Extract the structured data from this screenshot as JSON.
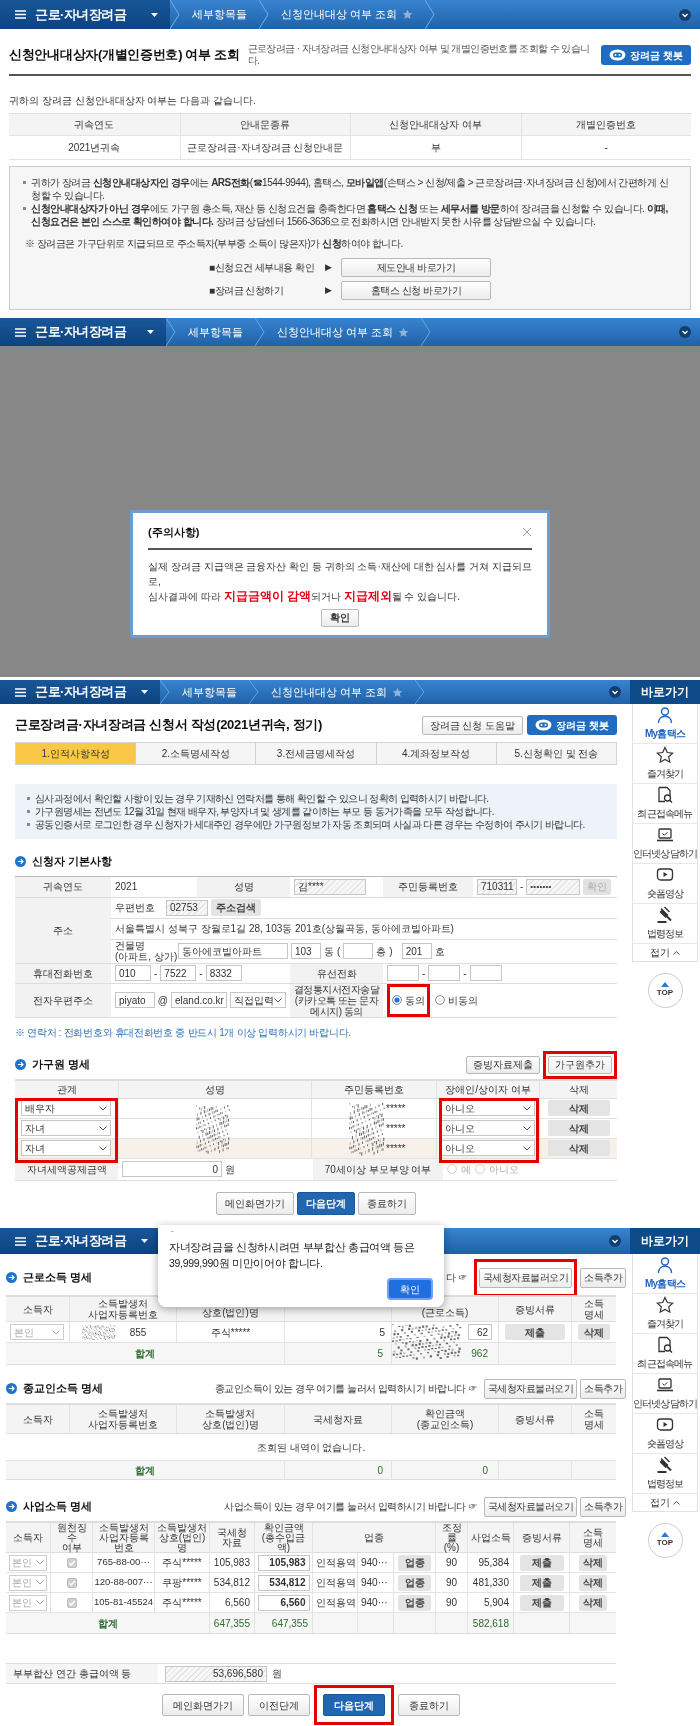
{
  "screen1": {
    "nav": {
      "menu": "근로·자녀장려금",
      "breadcrumbs": [
        {
          "label": "세부항목들"
        },
        {
          "label": "신청안내대상 여부 조회",
          "favorite": false
        }
      ]
    },
    "title": "신청안내대상자(개별인증번호) 여부 조회",
    "subtitle": "근로장려금 · 자녀장려금 신청안내대상자 여부 및 개별인증번호를 조회할 수 있습니다.",
    "chatbot": "장려금 챗봇",
    "intro": "귀하의 장려금 신청안내대상자 여부는 다음과 같습니다.",
    "table": {
      "columns": [
        "귀속연도",
        "안내문종류",
        "신청안내대상자 여부",
        "개별인증번호"
      ],
      "rows": [
        [
          "2021년귀속",
          "근로장려금·자녀장려금 신청안내문",
          "부",
          "-"
        ]
      ]
    },
    "notices": [
      "귀하가 장려금 **신청안내대상자인 경우**에는 **ARS전화**(☎1544-9944), 홈택스, **모바일앱**(손택스 > 신청/제출 > 근로장려금·자녀장려금 신청)에서 간편하게 신청할 수 있습니다.",
      "**신청안내대상자가 아닌 경우**에도 가구원 총소득, 재산 등 신청요건을 충족한다면 **홈택스 신청** 또는 **세무서를 방문**하여 장려금을 신청할 수 있습니다. **이때, 신청요건은 본인 스스로 확인하여야 합니다.** 장려금 상담센터 1566-3636으로 전화하시면 안내받지 못한 사유를 상담받으실 수 있습니다."
    ],
    "note": "※ 장려금은 가구단위로 지급되므로 주소득자(부부중 소득이 많은자)가 **신청**하여야 합니다.",
    "links": [
      {
        "label": "■신청요건 세부내용 확인",
        "arrow": "▶",
        "button": "제도안내 바로가기"
      },
      {
        "label": "■장려금 신청하기",
        "arrow": "▶",
        "button": "홈택스 신청 바로가기"
      }
    ]
  },
  "screen2": {
    "nav": {
      "menu": "근로·자녀장려금",
      "breadcrumbs": [
        {
          "label": "세부항목들"
        },
        {
          "label": "신청안내대상 여부 조회",
          "favorite": false
        }
      ]
    },
    "dialog": {
      "title": "(주의사항)",
      "lines": [
        "실제 장려금 지급액은 금융자산 확인 등 귀하의 소득·재산에 대한 심사를 거쳐 지급되므로,",
        "심사결과에 따라 **지급금액이 감액**되거나 **지급제외**될 수 있습니다."
      ],
      "button": "확인"
    }
  },
  "screen3": {
    "nav": {
      "menu": "근로·자녀장려금",
      "breadcrumbs": [
        {
          "label": "세부항목들"
        },
        {
          "label": "신청안내대상 여부 조회",
          "favorite": false
        }
      ]
    },
    "quick_menu": {
      "title": "바로가기",
      "items": [
        {
          "label": "My홈택스",
          "selected": true
        },
        {
          "label": "즐겨찾기",
          "selected": false
        },
        {
          "label": "최근접속메뉴",
          "selected": false
        },
        {
          "label": "인터넷상담하기",
          "selected": false
        },
        {
          "label": "숏폼영상",
          "selected": false
        },
        {
          "label": "법령정보",
          "selected": false
        }
      ],
      "collapse": "접기",
      "top": "TOP"
    },
    "title": "근로장려금·자녀장려금 신청서 작성(2021년귀속, 정기)",
    "help_button": "장려금 신청 도움말",
    "chatbot": "장려금 챗봇",
    "steps": [
      {
        "label": "1.인적사항작성",
        "selected": true
      },
      {
        "label": "2.소득명세작성",
        "selected": false
      },
      {
        "label": "3.전세금명세작성",
        "selected": false
      },
      {
        "label": "4.계좌정보작성",
        "selected": false
      },
      {
        "label": "5.신청확인 및 전송",
        "selected": false
      }
    ],
    "notices": [
      "심사과정에서 확인할 사항이 있는 경우 기재하신 연락처를 통해 확인할 수 있으니 정확히 입력하시기 바랍니다.",
      "가구원명세는 전년도 12월 31일 현재 배우자, 부양자녀 및 생계를 같이하는 부모 등 동거가족을 모두 작성합니다.",
      "공동인증서로 로그인한 경우 신청자가 세대주인 경우에만 가구원정보가 자동 조회되며 사실과 다른 경우는 수정하여 주시기 바랍니다."
    ],
    "basic": {
      "title": "신청자 기본사항",
      "year_label": "귀속연도",
      "year": "2021",
      "name_label": "성명",
      "name": "김****",
      "rrn_label": "주민등록번호",
      "rrn_front": "710311",
      "dash": "-",
      "rrn_back": "• • • • • • •",
      "rrn_confirm": "확인",
      "rrn_confirm_disabled": true,
      "address_label": "주소",
      "postal_label": "우편번호",
      "postal": "02753",
      "address_search": "주소검색",
      "address": "서울특별시 성북구 장월로1길 28, 103동 201호(상월곡동, 동아에코빌아파트)",
      "building_label": "건물명",
      "building_hint": "(아파트, 상가)",
      "building": "동아에코빌아파트",
      "dong": "103",
      "dong_unit": "동",
      "floor_open": "(",
      "floor_unit": "층",
      "floor_close": ")",
      "ho": "201",
      "ho_unit": "호",
      "mobile_label": "휴대전화번호",
      "mobile": [
        "010",
        "7522",
        "8332"
      ],
      "landline_label": "유선전화",
      "email_label": "전자우편주소",
      "email_id": "piyato",
      "email_at": "@",
      "email_domain": "eland.co.kr",
      "email_select": "직접입력",
      "consent_label": "결정통지서전자송달(카카오톡 또는 문자메시지) 동의",
      "consent_options": [
        {
          "label": "동의",
          "selected": true,
          "highlighted": true
        },
        {
          "label": "비동의",
          "selected": false,
          "highlighted": false
        }
      ]
    },
    "contact_note": "※ 연락처 : 전화번호와 휴대전화번호 중 반드시 1개 이상 입력하시기 바랍니다.",
    "household": {
      "title": "가구원 명세",
      "buttons": [
        {
          "label": "증빙자료제출",
          "highlighted": false
        },
        {
          "label": "가구원추가",
          "highlighted": true
        }
      ],
      "columns": [
        "관계",
        "성명",
        "주민등록번호",
        "장애인/상이자 여부",
        "삭제"
      ],
      "relation_highlighted": true,
      "disability_highlighted": true,
      "redacted": true,
      "rows": [
        {
          "relation": "배우자",
          "rrn": "*****",
          "disability": "아니오",
          "delete": "삭제",
          "selected": false
        },
        {
          "relation": "자녀",
          "rrn": "*****",
          "disability": "아니오",
          "delete": "삭제",
          "selected": false
        },
        {
          "relation": "자녀",
          "rrn": "*****",
          "disability": "아니오",
          "delete": "삭제",
          "selected": true
        }
      ],
      "child_credit_label": "자녀세액공제금액",
      "child_credit": "0",
      "child_credit_unit": "원",
      "elder_label": "70세이상 부모부양 여부",
      "elder_options": [
        {
          "label": "예",
          "selected": false
        },
        {
          "label": "아니오",
          "selected": false
        }
      ],
      "elder_disabled": true
    },
    "buttons": [
      {
        "label": "메인화면가기",
        "kind": "default"
      },
      {
        "label": "다음단계",
        "kind": "primary"
      },
      {
        "label": "종료하기",
        "kind": "default"
      }
    ]
  },
  "screen4": {
    "nav": {
      "menu": "근로·자녀장려금"
    },
    "quick_menu": {
      "title": "바로가기",
      "items": [
        {
          "label": "My홈택스",
          "selected": true
        },
        {
          "label": "즐겨찾기",
          "selected": false
        },
        {
          "label": "최근접속메뉴",
          "selected": false
        },
        {
          "label": "인터넷상담하기",
          "selected": false
        },
        {
          "label": "숏폼영상",
          "selected": false
        },
        {
          "label": "법령정보",
          "selected": false
        }
      ],
      "collapse": "접기",
      "top": "TOP"
    },
    "alert": {
      "title": "-",
      "message": "자녀장려금을 신청하시려면 부부합산 총급여액 등은 39,999,990원 미만이어야 합니다.",
      "button": "확인"
    },
    "wage": {
      "title": "근로소득 명세",
      "hint": "다 ☞",
      "buttons": [
        {
          "label": "국세청자료불러오기",
          "highlighted": true
        },
        {
          "label": "소득추가",
          "highlighted": false
        }
      ],
      "columns": [
        {
          "label": "소득자"
        },
        {
          "label": "소득발생처\n사업자등록번호"
        },
        {
          "label": "상호(법인)명",
          "kind": "partial"
        },
        {
          "kind": "covered"
        },
        {
          "label": "(근로소득)",
          "kind": "partial"
        },
        {
          "label": "증빙서류"
        },
        {
          "label": "소득\n명세"
        }
      ],
      "redacted": true,
      "rows": [
        {
          "owner": "본인",
          "reg_no": "855",
          "company": "주식*****",
          "nts": "5",
          "confirmed": "62",
          "proof": "제출",
          "delete": "삭제"
        }
      ],
      "total": {
        "label": "합계",
        "nts": "5",
        "confirmed": "962"
      }
    },
    "religious": {
      "title": "종교인소득 명세",
      "hint": "종교인소득이 있는 경우 여기를 눌러서 입력하시기 바랍니다 ☞",
      "buttons": [
        {
          "label": "국세청자료불러오기",
          "highlighted": false
        },
        {
          "label": "소득추가",
          "highlighted": false
        }
      ],
      "columns": [
        {
          "label": "소득자"
        },
        {
          "label": "소득발생처\n사업자등록번호"
        },
        {
          "label": "소득발생처\n상호(법인)명"
        },
        {
          "label": "국세청자료"
        },
        {
          "label": "확인금액\n(종교인소득)"
        },
        {
          "label": "증빙서류"
        },
        {
          "label": "소득\n명세"
        }
      ],
      "empty": "조회된 내역이 없습니다.",
      "total": {
        "label": "합계",
        "nts": "0",
        "confirmed": "0"
      }
    },
    "business": {
      "title": "사업소득 명세",
      "hint": "사업소득이 있는 경우 여기를 눌러서 입력하시기 바랍니다 ☞",
      "buttons": [
        {
          "label": "국세청자료불러오기",
          "highlighted": false
        },
        {
          "label": "소득추가",
          "highlighted": false
        }
      ],
      "columns": [
        "소득자",
        "원천징수\n여부",
        "소득발생처\n사업자등록번호",
        "소득발생처\n상호(법인)명",
        "국세청\n자료",
        "확인금액\n(총수입금액)",
        "업종",
        "조정률\n(%)",
        "사업소득",
        "증빙서류",
        "소득\n명세"
      ],
      "rows": [
        {
          "owner": "본인",
          "withheld": true,
          "reg_no": "765-88-00···",
          "company": "주식*****",
          "nts": "105,983",
          "confirmed": "105,983",
          "industry": "인적용역",
          "code": "940···",
          "industry_button": "업종",
          "rate": "90",
          "income": "95,384",
          "proof": "제출",
          "delete": "삭제"
        },
        {
          "owner": "본인",
          "withheld": true,
          "reg_no": "120-88-007···",
          "company": "쿠팡*****",
          "nts": "534,812",
          "confirmed": "534,812",
          "industry": "인적용역",
          "code": "940···",
          "industry_button": "업종",
          "rate": "90",
          "income": "481,330",
          "proof": "제출",
          "delete": "삭제"
        },
        {
          "owner": "본인",
          "withheld": true,
          "reg_no": "105-81-45524",
          "company": "주식*****",
          "nts": "6,560",
          "confirmed": "6,560",
          "industry": "인적용역",
          "code": "940···",
          "industry_button": "업종",
          "rate": "90",
          "income": "5,904",
          "proof": "제출",
          "delete": "삭제"
        }
      ],
      "total": {
        "label": "합계",
        "nts": "647,355",
        "confirmed": "647,355",
        "income": "582,618"
      }
    },
    "combined": {
      "label": "부부합산 연간 총급여액 등",
      "value": "53,696,580",
      "unit": "원"
    },
    "buttons": [
      {
        "label": "메인화면가기",
        "kind": "default",
        "highlighted": false
      },
      {
        "label": "이전단계",
        "kind": "default",
        "highlighted": false
      },
      {
        "label": "다음단계",
        "kind": "primary",
        "highlighted": true
      },
      {
        "label": "종료하기",
        "kind": "default",
        "highlighted": false
      }
    ]
  }
}
